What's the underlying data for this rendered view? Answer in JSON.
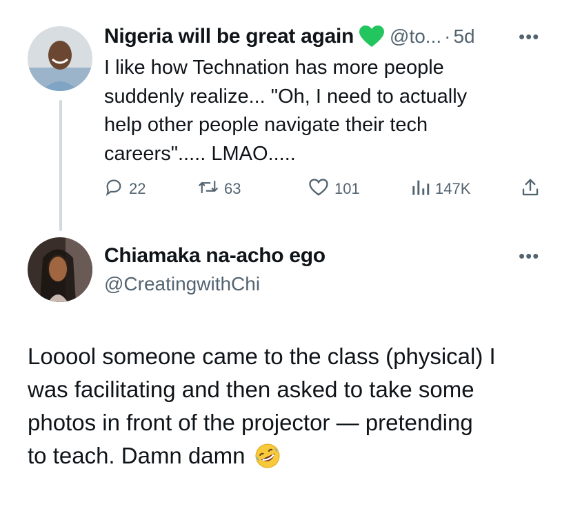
{
  "reply_tweet": {
    "display_name": "Nigeria will be great again",
    "verified_emoji": "green-heart",
    "handle": "@to...",
    "separator": "·",
    "time": "5d",
    "text_lines": [
      "I like how Technation has more people",
      "suddenly realize... \"Oh, I need to actually",
      "help other people navigate their tech",
      "careers\"..... LMAO....."
    ],
    "metrics": {
      "replies": "22",
      "retweets": "63",
      "likes": "101",
      "views": "147K"
    }
  },
  "main_tweet": {
    "display_name": "Chiamaka na-acho ego",
    "handle": "@CreatingwithChi",
    "text_lines": [
      "Looool someone came to the class (physical) I",
      "was facilitating and then asked to take some",
      "photos in front of the projector — pretending",
      "to teach. Damn damn"
    ],
    "emoji": "rolling-on-floor-laughing"
  },
  "colors": {
    "text": "#0f1419",
    "muted": "#536471",
    "heart_green": "#22c55e",
    "thread_line": "#cfd9de"
  }
}
